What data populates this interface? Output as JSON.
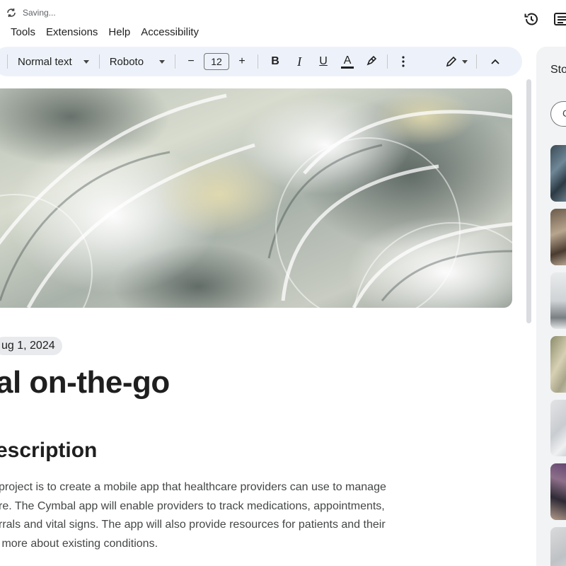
{
  "status": {
    "saving_text": "Saving..."
  },
  "menu": [
    "Tools",
    "Extensions",
    "Help",
    "Accessibility"
  ],
  "toolbar": {
    "style": "Normal text",
    "font": "Roboto",
    "decrease": "−",
    "font_size": "12",
    "increase": "+",
    "bold": "B",
    "italic": "I",
    "underline": "U",
    "text_color": "A"
  },
  "side_panel": {
    "title": "Sto",
    "button_label": "C"
  },
  "document": {
    "date": "ug 1, 2024",
    "title": "al on-the-go",
    "heading": "escription",
    "paragraph_lines": [
      "project is to create a mobile app that healthcare providers can use to manage",
      "re.  The Cymbal app will enable providers to track medications, appointments,",
      "rrals and vital signs. The app will also provide resources for patients and their",
      " more about existing conditions."
    ]
  },
  "colors": {
    "toolbar_bg": "#edf2fa",
    "side_panel_bg": "#f1f3f4",
    "chip_bg": "#e8eaed",
    "text": "#1f1f1f",
    "body_text": "#444746"
  },
  "icons": [
    "sync-icon",
    "history-icon",
    "comments-icon",
    "highlighter-icon",
    "more-vert-icon",
    "edit-mode-icon",
    "collapse-icon"
  ]
}
